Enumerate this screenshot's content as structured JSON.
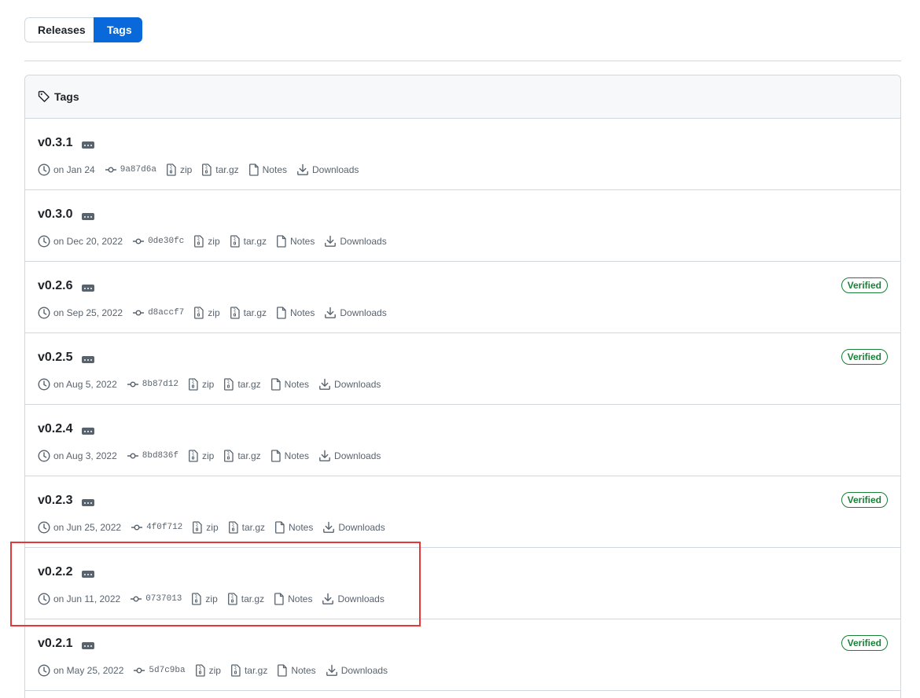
{
  "tabs": {
    "releases_label": "Releases",
    "tags_label": "Tags"
  },
  "header": {
    "title": "Tags"
  },
  "labels": {
    "zip": "zip",
    "targz": "tar.gz",
    "notes": "Notes",
    "downloads": "Downloads",
    "verified": "Verified"
  },
  "colors": {
    "accent": "#0969da",
    "verified": "#1a7f37",
    "highlight": "#e5383b"
  },
  "tags": [
    {
      "name": "v0.3.1",
      "date": "on Jan 24",
      "sha": "9a87d6a",
      "verified": false
    },
    {
      "name": "v0.3.0",
      "date": "on Dec 20, 2022",
      "sha": "0de30fc",
      "verified": false
    },
    {
      "name": "v0.2.6",
      "date": "on Sep 25, 2022",
      "sha": "d8accf7",
      "verified": true
    },
    {
      "name": "v0.2.5",
      "date": "on Aug 5, 2022",
      "sha": "8b87d12",
      "verified": true
    },
    {
      "name": "v0.2.4",
      "date": "on Aug 3, 2022",
      "sha": "8bd836f",
      "verified": false
    },
    {
      "name": "v0.2.3",
      "date": "on Jun 25, 2022",
      "sha": "4f0f712",
      "verified": true
    },
    {
      "name": "v0.2.2",
      "date": "on Jun 11, 2022",
      "sha": "0737013",
      "verified": false,
      "highlighted": true
    },
    {
      "name": "v0.2.1",
      "date": "on May 25, 2022",
      "sha": "5d7c9ba",
      "verified": true
    }
  ]
}
